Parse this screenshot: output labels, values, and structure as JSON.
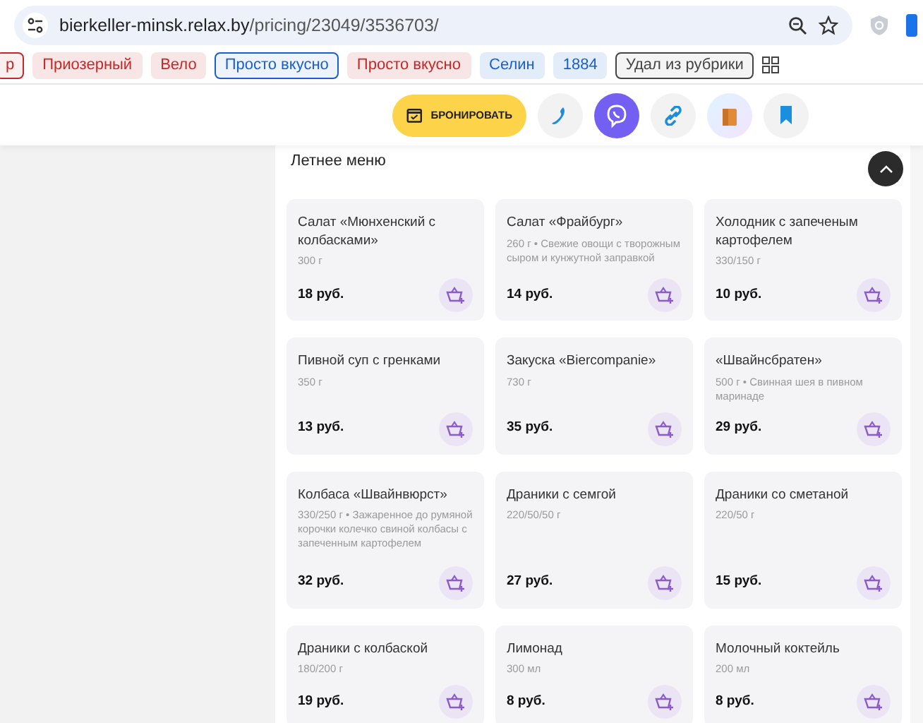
{
  "address_bar": {
    "url_host": "bierkeller-minsk.relax.by",
    "url_path": "/pricing/23049/3536703/"
  },
  "bookmarks": [
    {
      "label": "р",
      "color": "#c62828",
      "outlined": true
    },
    {
      "label": "Приозерный",
      "color": "#c62828",
      "outlined": false
    },
    {
      "label": "Вело",
      "color": "#c62828",
      "outlined": false
    },
    {
      "label": "Просто вкусно",
      "color": "#1a5fd0",
      "outlined": true
    },
    {
      "label": "Просто вкусно",
      "color": "#c62828",
      "outlined": false
    },
    {
      "label": "Селин",
      "color": "#1a5fd0",
      "outlined": false
    },
    {
      "label": "1884",
      "color": "#1a5fd0",
      "outlined": false
    },
    {
      "label": "Удал из рубрики",
      "color": "#444444",
      "outlined": true
    }
  ],
  "actions": {
    "book_label": "БРОНИРОВАТЬ"
  },
  "section": {
    "title": "Летнее меню"
  },
  "menu_items": [
    {
      "name": "Салат «Мюнхенский с колбасками»",
      "details": "300 г",
      "price": "18 руб."
    },
    {
      "name": "Салат «Фрайбург»",
      "details": "260 г • Свежие овощи с творожным сыром и кунжутной заправкой",
      "price": "14 руб."
    },
    {
      "name": "Холодник с запеченым картофелем",
      "details": "330/150 г",
      "price": "10 руб."
    },
    {
      "name": "Пивной суп с гренками",
      "details": "350 г",
      "price": "13 руб."
    },
    {
      "name": "Закуска «Biercompanie»",
      "details": "730 г",
      "price": "35 руб."
    },
    {
      "name": "«Швайнсбратен»",
      "details": "500 г • Свинная шея в пивном маринаде",
      "price": "29 руб."
    },
    {
      "name": "Колбаса «Швайнвюрст»",
      "details": "330/250 г • Зажаренное до румяной корочки колечко свиной колбасы с запеченным картофелем",
      "price": "32 руб."
    },
    {
      "name": "Драники с семгой",
      "details": "220/50/50 г",
      "price": "27 руб."
    },
    {
      "name": "Драники со сметаной",
      "details": "220/50 г",
      "price": "15 руб."
    },
    {
      "name": "Драники с колбаской",
      "details": "180/200 г",
      "price": "19 руб."
    },
    {
      "name": "Лимонад",
      "details": "300 мл",
      "price": "8 руб."
    },
    {
      "name": "Молочный коктейль",
      "details": "200 мл",
      "price": "8 руб."
    }
  ]
}
